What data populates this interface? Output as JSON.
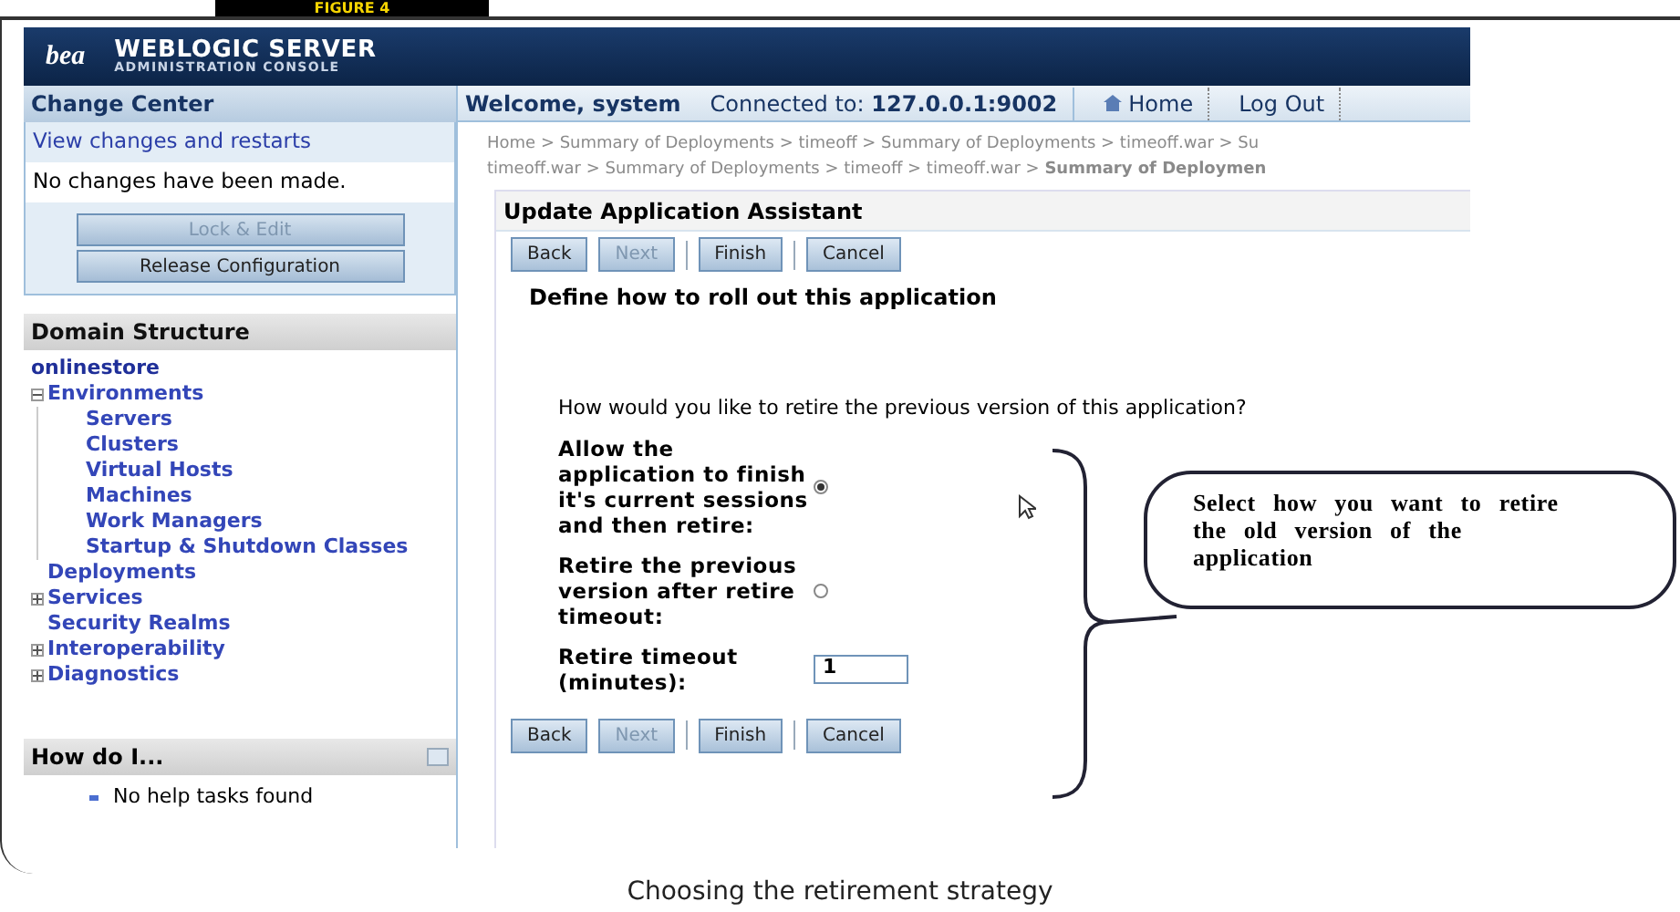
{
  "figure_label": "FIGURE 4",
  "header": {
    "logo": "bea",
    "title": "WEBLOGIC SERVER",
    "subtitle": "ADMINISTRATION CONSOLE"
  },
  "change_center": {
    "title": "Change Center",
    "link": "View changes and restarts",
    "message": "No changes have been made.",
    "buttons": [
      {
        "label": "Lock & Edit",
        "disabled": true
      },
      {
        "label": "Release Configuration",
        "disabled": false
      }
    ]
  },
  "domain_structure": {
    "title": "Domain Structure",
    "root": "onlinestore",
    "items": [
      {
        "label": "Environments",
        "kind": "group",
        "expanded": true,
        "children": [
          {
            "label": "Servers"
          },
          {
            "label": "Clusters"
          },
          {
            "label": "Virtual Hosts"
          },
          {
            "label": "Machines"
          },
          {
            "label": "Work Managers"
          },
          {
            "label": "Startup & Shutdown Classes"
          }
        ]
      },
      {
        "label": "Deployments",
        "kind": "leaf"
      },
      {
        "label": "Services",
        "kind": "group",
        "expanded": false
      },
      {
        "label": "Security Realms",
        "kind": "leaf"
      },
      {
        "label": "Interoperability",
        "kind": "group",
        "expanded": false
      },
      {
        "label": "Diagnostics",
        "kind": "group",
        "expanded": false
      }
    ]
  },
  "how_do_i": {
    "title": "How do I...",
    "items": [
      "No help tasks found"
    ]
  },
  "top_bar": {
    "welcome": "Welcome, system",
    "connected_label": "Connected to:",
    "address": "127.0.0.1:9002",
    "links": [
      "Home",
      "Log Out"
    ]
  },
  "breadcrumbs": [
    "Home > Summary of Deployments > timeoff > Summary of Deployments > timeoff.war > Su",
    "timeoff.war > Summary of Deployments > timeoff > timeoff.war > **Summary of Deploymen**"
  ],
  "assistant": {
    "title": "Update Application Assistant",
    "buttons": [
      {
        "label": "Back",
        "disabled": false
      },
      {
        "label": "Next",
        "disabled": true
      },
      {
        "label": "Finish",
        "disabled": false
      },
      {
        "label": "Cancel",
        "disabled": false
      }
    ],
    "bottom_buttons": [
      {
        "label": "Back",
        "disabled": false
      },
      {
        "label": "Next",
        "disabled": true
      },
      {
        "label": "Finish",
        "disabled": false
      },
      {
        "label": "Cancel",
        "disabled": false
      }
    ],
    "heading": "Define how to roll out this application",
    "question": "How would you like to retire the previous version of this application?",
    "options": [
      {
        "kind": "radio",
        "label": "Allow the application to finish it's current sessions and then retire:",
        "selected": true
      },
      {
        "kind": "radio",
        "label": "Retire the previous version after retire timeout:",
        "selected": false
      },
      {
        "kind": "input",
        "label": "Retire timeout (minutes):",
        "value": "1"
      }
    ]
  },
  "callout": "Select how you want to retire the old version of the application",
  "caption": "Choosing the retirement strategy"
}
